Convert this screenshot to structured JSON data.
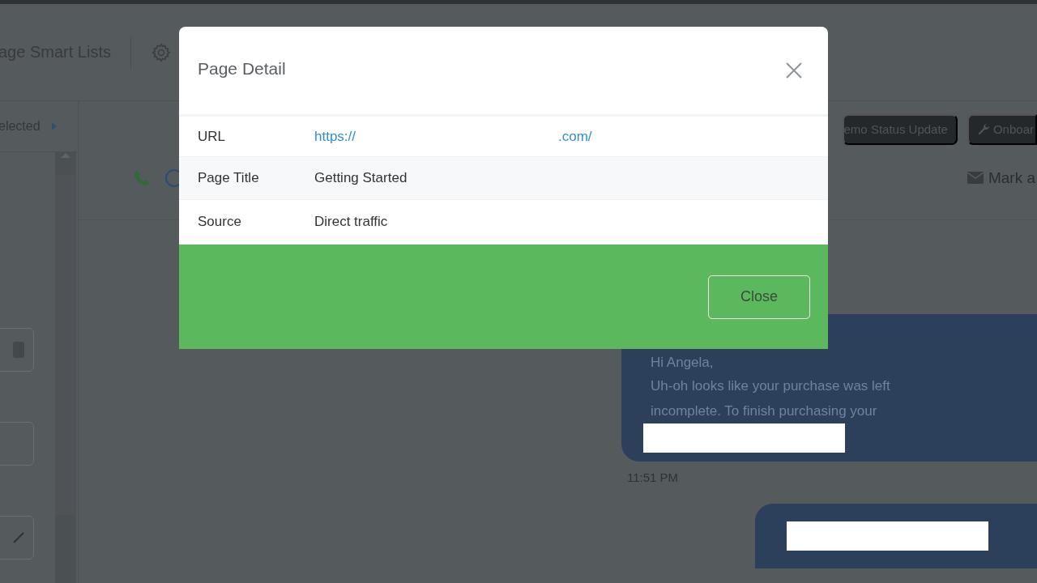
{
  "background": {
    "header_title": "age Smart Lists",
    "filter_label": "elected",
    "chips": [
      {
        "label": "emo Status Update",
        "kind": "plain"
      },
      {
        "label": "Onboar",
        "kind": "wrench"
      }
    ],
    "mark_action": "Mark a",
    "message": {
      "greeting": "Hi Angela,",
      "body": "Uh-oh looks like your purchase was left incomplete. To finish purchasing your",
      "time": "11:51 PM"
    }
  },
  "modal": {
    "title": "Page Detail",
    "rows": [
      {
        "label": "URL",
        "kind": "link",
        "value_start": "https://",
        "value_end": ".com/"
      },
      {
        "label": "Page Title",
        "kind": "text",
        "value": "Getting Started"
      },
      {
        "label": "Source",
        "kind": "text",
        "value": "Direct traffic"
      }
    ],
    "close_label": "Close"
  }
}
